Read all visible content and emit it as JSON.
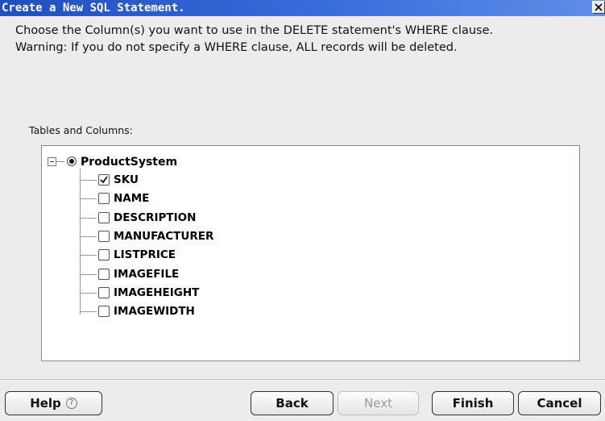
{
  "window": {
    "title": "Create a New SQL Statement.",
    "close_label": "x"
  },
  "instructions": {
    "line1": "Choose the Column(s) you want to use in the DELETE statement's WHERE clause.",
    "line2": "Warning: If you do not specify a WHERE clause, ALL records will be deleted."
  },
  "tree": {
    "label": "Tables and Columns:",
    "root": {
      "name": "ProductSystem",
      "selected": true,
      "expanded": true
    },
    "columns": [
      {
        "name": "SKU",
        "checked": true
      },
      {
        "name": "NAME",
        "checked": false
      },
      {
        "name": "DESCRIPTION",
        "checked": false
      },
      {
        "name": "MANUFACTURER",
        "checked": false
      },
      {
        "name": "LISTPRICE",
        "checked": false
      },
      {
        "name": "IMAGEFILE",
        "checked": false
      },
      {
        "name": "IMAGEHEIGHT",
        "checked": false
      },
      {
        "name": "IMAGEWIDTH",
        "checked": false
      }
    ]
  },
  "buttons": {
    "help": "Help",
    "help_icon": "?",
    "back": "Back",
    "next": "Next",
    "finish": "Finish",
    "cancel": "Cancel"
  }
}
